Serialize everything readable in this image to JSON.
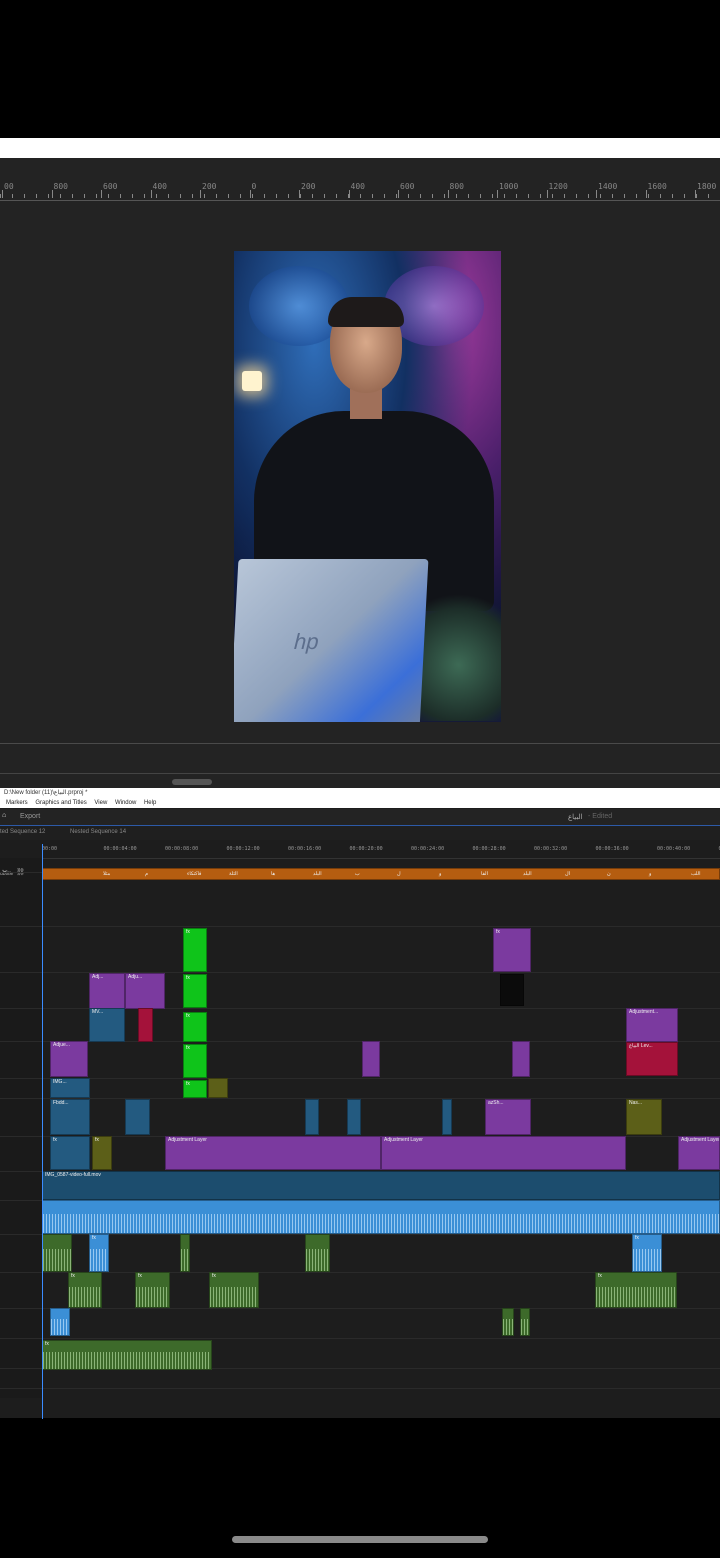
{
  "ruler": {
    "labels": [
      "00",
      "800",
      "600",
      "400",
      "200",
      "0",
      "200",
      "400",
      "600",
      "800",
      "1000",
      "1200",
      "1400",
      "1600",
      "1800"
    ]
  },
  "video": {
    "laptop_logo": "hp"
  },
  "window": {
    "title": "D:\\New folder (11)\\البياع.prproj *",
    "menu": [
      "Markers",
      "Graphics and Titles",
      "View",
      "Window",
      "Help"
    ]
  },
  "workspace": {
    "home_icon": "home-icon",
    "export_label": "Export",
    "project_name": "البياع",
    "edited_label": "- Edited"
  },
  "sequences": {
    "tab1": "ted Sequence 12",
    "tab2": "Nested Sequence 14"
  },
  "timeline": {
    "timecodes": [
      "00:00",
      "00:00:04:00",
      "00:00:08:00",
      "00:00:12:00",
      "00:00:16:00",
      "00:00:20:00",
      "00:00:24:00",
      "00:00:28:00",
      "00:00:32:00",
      "00:00:36:00",
      "00:00:40:00",
      "00:00:4"
    ],
    "subtitle_track": "ubtitle",
    "subtitle_words": [
      "مثلا",
      "م",
      "فاكتكاء",
      "الثلة",
      "ها",
      "البلد",
      "ب",
      "ل",
      "و",
      "الفا",
      "البلد",
      "ال",
      "ن",
      "و",
      "اللب"
    ],
    "clip_labels": {
      "adjustment_layer": "Adjustment Layer",
      "adjustment_short": "Adjustment...",
      "adj1": "Adj...",
      "adj2": "Adju...",
      "adjue": "Adjue...",
      "img_full": "IMG_0587-video-full.mov",
      "img_short": "IMG_0...",
      "img_0587": "IMG_0587...",
      "img": "IMG...",
      "ima": "IMA...",
      "fx": "fx",
      "nas": "Nas...",
      "azsh": "azSh...",
      "fbsd": "Fbdd...",
      "mv": "MV...",
      "albaya": "البياع Lev..."
    }
  },
  "colors": {
    "purple": "#7b3a9f",
    "green": "#0fc41a",
    "video_blue": "#235a80",
    "audio_blue": "#3b8fd6",
    "audio_green": "#3d6a2a",
    "subtitle_orange": "#b55d10",
    "playhead": "#3b8cff"
  }
}
